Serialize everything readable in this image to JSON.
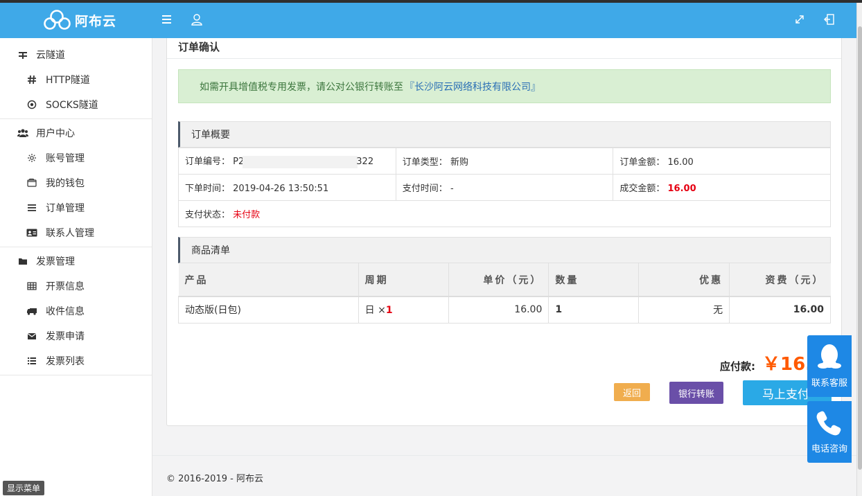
{
  "brand": {
    "name": "阿布云"
  },
  "sidebar": {
    "groups": [
      {
        "label": "云隧道",
        "icon": "tunnel-icon",
        "items": [
          {
            "label": "HTTP隧道",
            "icon": "hash-icon"
          },
          {
            "label": "SOCKS隧道",
            "icon": "circle-dot-icon"
          }
        ]
      },
      {
        "label": "用户中心",
        "icon": "users-icon",
        "items": [
          {
            "label": "账号管理",
            "icon": "gear-icon"
          },
          {
            "label": "我的钱包",
            "icon": "wallet-icon"
          },
          {
            "label": "订单管理",
            "icon": "list-icon"
          },
          {
            "label": "联系人管理",
            "icon": "contact-card-icon"
          }
        ]
      },
      {
        "label": "发票管理",
        "icon": "folder-icon",
        "items": [
          {
            "label": "开票信息",
            "icon": "table-icon"
          },
          {
            "label": "收件信息",
            "icon": "truck-icon"
          },
          {
            "label": "发票申请",
            "icon": "envelope-icon"
          },
          {
            "label": "发票列表",
            "icon": "list-ul-icon"
          }
        ]
      }
    ],
    "toggle_label": "显示菜单"
  },
  "page": {
    "title": "订单确认",
    "notice_text": "如需开具增值税专用发票，请公对公银行转账至",
    "notice_company": "『长沙阿云网络科技有限公司』"
  },
  "summary": {
    "heading": "订单概要",
    "order_no_label": "订单编号：",
    "order_no_prefix": "P2",
    "order_no_suffix": "322",
    "order_type_label": "订单类型：",
    "order_type": "新购",
    "order_amount_label": "订单金额：",
    "order_amount": "16.00",
    "created_label": "下单时间：",
    "created_time": "2019-04-26 13:50:51",
    "paid_label": "支付时间：",
    "paid_time": "-",
    "deal_label": "成交金额：",
    "deal_amount": "16.00",
    "status_label": "支付状态：",
    "status": "未付款"
  },
  "products": {
    "heading": "商品清单",
    "columns": [
      "产品",
      "周期",
      "单价（元）",
      "数量",
      "优惠",
      "资费（元）"
    ],
    "rows": [
      {
        "product": "动态版(日包)",
        "period": "日 ×",
        "period_qty": "1",
        "unit_price": "16.00",
        "quantity": "1",
        "discount": "无",
        "fee": "16.00"
      }
    ]
  },
  "payment": {
    "due_label": "应付款:",
    "due_amount": "￥16.",
    "back_label": "返回",
    "bank_label": "银行转账",
    "pay_label": "马上支付"
  },
  "footer": {
    "copyright": "© 2016-2019 - 阿布云"
  },
  "floating": {
    "service_label": "联系客服",
    "phone_label": "电话咨询"
  },
  "colors": {
    "header": "#3fa9e8",
    "accent_red": "#e60012",
    "due_orange": "#ff5a00",
    "back": "#f0ad4e",
    "bank": "#6a4fa8",
    "pay": "#2aa9e6",
    "float": "#1e88e5"
  }
}
